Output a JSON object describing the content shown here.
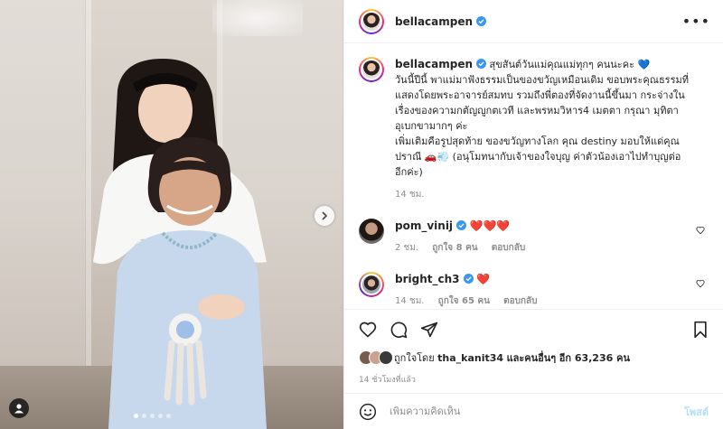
{
  "post": {
    "username": "bellacampen",
    "more_label": "•••"
  },
  "caption": {
    "username": "bellacampen",
    "lines": [
      "สุขสันต์วันแม่คุณแม่ทุกๆ คนนะคะ 💙",
      "วันนี้ปีนี้ พาแม่มาฟังธรรมเป็นของขวัญเหมือนเดิม ขอบพระคุณธรรมที่",
      "แสดงโดยพระอาจารย์สมทบ รวมถึงพี่ตองที่จัดงานนี้ขึ้นมา กระจ่างใน",
      "เรื่องของความกตัญญูกตเวที และพรหมวิหาร4 เมตตา กรุณา มุทิตา",
      "อุเบกขามากๆ ค่ะ",
      "เพิ่มเติมคือรูปสุดท้าย ของขวัญทางโลก คุณ destiny มอบให้แด่คุณ",
      "ปราณี 🚗💨 (อนุโมทนากับเจ้าของใจบุญ ค่าตัวน้องเอาไปทำบุญต่อ",
      "อีกค่ะ)"
    ],
    "time": "14 ชม."
  },
  "comments": [
    {
      "username": "pom_vinij",
      "text": "❤️❤️❤️",
      "verified": true,
      "time": "2 ชม.",
      "likes": "ถูกใจ 8 คน",
      "reply": "ตอบกลับ"
    },
    {
      "username": "bright_ch3",
      "text": "❤️",
      "verified": true,
      "time": "14 ชม.",
      "likes": "ถูกใจ 65 คน",
      "reply": "ตอบกลับ"
    }
  ],
  "likes": {
    "prefix": "ถูกใจโดย",
    "first_user": "tha_kanit34",
    "middle": "และคนอื่นๆ",
    "others_label": "อีก 63,236 คน"
  },
  "timestamp": "14 ชั่วโมงที่แล้ว",
  "comment_box": {
    "placeholder": "เพิ่มความคิดเห็น",
    "post_label": "โพสต์"
  },
  "icons": {
    "like": "heart-icon",
    "comment": "comment-icon",
    "share": "share-icon",
    "save": "bookmark-icon",
    "emoji": "emoji-icon",
    "next": "chevron-right-icon",
    "tags": "user-tag-icon"
  },
  "colors": {
    "verified": "#3897f0",
    "heart_red": "#e0143c",
    "post_button": "#b2dffc",
    "muted": "#8e8e8e"
  },
  "carousel": {
    "slides": 5,
    "active_index": 1
  }
}
